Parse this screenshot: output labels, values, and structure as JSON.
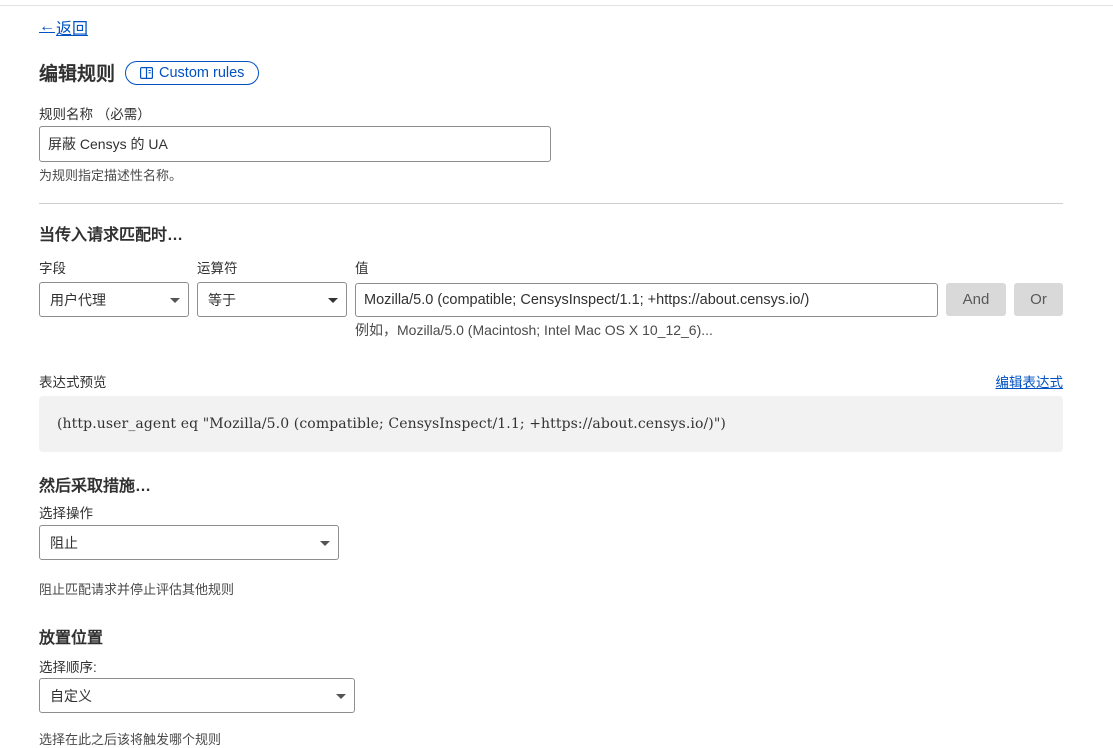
{
  "nav": {
    "back_label": "返回",
    "back_arrow": "←"
  },
  "header": {
    "title": "编辑规则",
    "docs_chip_label": "Custom rules",
    "docs_icon": "book-icon"
  },
  "rule_name": {
    "label": "规则名称 （必需）",
    "value": "屏蔽 Censys 的 UA",
    "help": "为规则指定描述性名称。"
  },
  "match": {
    "section_title": "当传入请求匹配时…",
    "field_label": "字段",
    "field_value": "用户代理",
    "operator_label": "运算符",
    "operator_value": "等于",
    "value_label": "值",
    "value_value": "Mozilla/5.0 (compatible; CensysInspect/1.1; +https://about.censys.io/)",
    "value_hint": "例如，Mozilla/5.0 (Macintosh; Intel Mac OS X 10_12_6)...",
    "and_label": "And",
    "or_label": "Or"
  },
  "expression": {
    "label": "表达式预览",
    "edit_link": "编辑表达式",
    "text": "(http.user_agent eq \"Mozilla/5.0 (compatible; CensysInspect/1.1; +https://about.censys.io/)\")"
  },
  "action": {
    "section_title": "然后采取措施…",
    "select_label": "选择操作",
    "select_value": "阻止",
    "help": "阻止匹配请求并停止评估其他规则"
  },
  "placement": {
    "section_title": "放置位置",
    "select_label": "选择顺序:",
    "select_value": "自定义",
    "help_partial": "选择在此之后该将触发哪个规则"
  },
  "colors": {
    "link": "#0051c3",
    "text": "#313131",
    "button_gray": "#d9d9d9"
  }
}
